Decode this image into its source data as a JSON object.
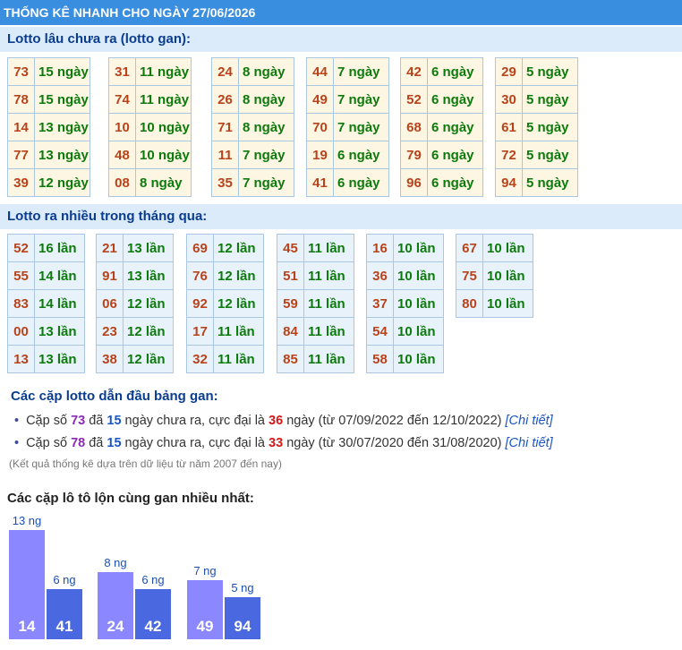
{
  "header": {
    "title": "THỐNG KÊ NHANH CHO NGÀY 27/06/2026"
  },
  "gan": {
    "title": "Lotto lâu chưa ra (lotto gan):",
    "columns": [
      [
        [
          "73",
          "15 ngày"
        ],
        [
          "78",
          "15 ngày"
        ],
        [
          "14",
          "13 ngày"
        ],
        [
          "77",
          "13 ngày"
        ],
        [
          "39",
          "12 ngày"
        ]
      ],
      [
        [
          "31",
          "11 ngày"
        ],
        [
          "74",
          "11 ngày"
        ],
        [
          "10",
          "10 ngày"
        ],
        [
          "48",
          "10 ngày"
        ],
        [
          "08",
          "8 ngày"
        ]
      ],
      [
        [
          "24",
          "8 ngày"
        ],
        [
          "26",
          "8 ngày"
        ],
        [
          "71",
          "8 ngày"
        ],
        [
          "11",
          "7 ngày"
        ],
        [
          "35",
          "7 ngày"
        ]
      ],
      [
        [
          "44",
          "7 ngày"
        ],
        [
          "49",
          "7 ngày"
        ],
        [
          "70",
          "7 ngày"
        ],
        [
          "19",
          "6 ngày"
        ],
        [
          "41",
          "6 ngày"
        ]
      ],
      [
        [
          "42",
          "6 ngày"
        ],
        [
          "52",
          "6 ngày"
        ],
        [
          "68",
          "6 ngày"
        ],
        [
          "79",
          "6 ngày"
        ],
        [
          "96",
          "6 ngày"
        ]
      ],
      [
        [
          "29",
          "5 ngày"
        ],
        [
          "30",
          "5 ngày"
        ],
        [
          "61",
          "5 ngày"
        ],
        [
          "72",
          "5 ngày"
        ],
        [
          "94",
          "5 ngày"
        ]
      ]
    ]
  },
  "nhieu": {
    "title": "Lotto ra nhiều trong tháng qua:",
    "columns": [
      [
        [
          "52",
          "16 lần"
        ],
        [
          "55",
          "14 lần"
        ],
        [
          "83",
          "14 lần"
        ],
        [
          "00",
          "13 lần"
        ],
        [
          "13",
          "13 lần"
        ]
      ],
      [
        [
          "21",
          "13 lần"
        ],
        [
          "91",
          "13 lần"
        ],
        [
          "06",
          "12 lần"
        ],
        [
          "23",
          "12 lần"
        ],
        [
          "38",
          "12 lần"
        ]
      ],
      [
        [
          "69",
          "12 lần"
        ],
        [
          "76",
          "12 lần"
        ],
        [
          "92",
          "12 lần"
        ],
        [
          "17",
          "11 lần"
        ],
        [
          "32",
          "11 lần"
        ]
      ],
      [
        [
          "45",
          "11 lần"
        ],
        [
          "51",
          "11 lần"
        ],
        [
          "59",
          "11 lần"
        ],
        [
          "84",
          "11 lần"
        ],
        [
          "85",
          "11 lần"
        ]
      ],
      [
        [
          "16",
          "10 lần"
        ],
        [
          "36",
          "10 lần"
        ],
        [
          "37",
          "10 lần"
        ],
        [
          "54",
          "10 lần"
        ],
        [
          "58",
          "10 lần"
        ]
      ],
      [
        [
          "67",
          "10 lần"
        ],
        [
          "75",
          "10 lần"
        ],
        [
          "80",
          "10 lần"
        ]
      ]
    ]
  },
  "leader": {
    "title": "Các cặp lotto dẫn đầu bảng gan:",
    "items": [
      {
        "p1": "Cặp số ",
        "pair": "73",
        "p2": " đã ",
        "days": "15",
        "p3": " ngày chưa ra, cực đại là ",
        "max": "36",
        "p4": " ngày (từ 07/09/2022 đến 12/10/2022) ",
        "link": "[Chi tiết]"
      },
      {
        "p1": "Cặp số ",
        "pair": "78",
        "p2": " đã ",
        "days": "15",
        "p3": " ngày chưa ra, cực đại là ",
        "max": "33",
        "p4": " ngày (từ 30/07/2020 đến 31/08/2020) ",
        "link": "[Chi tiết]"
      }
    ],
    "note": "(Kết quả thống kê dựa trên dữ liệu từ năm 2007 đến nay)"
  },
  "pairs": {
    "title": "Các cặp lô tô lộn cùng gan nhiều nhất:",
    "chart_data": {
      "type": "bar",
      "groups": [
        {
          "bars": [
            {
              "label": "14",
              "value": 13,
              "text": "13 ng"
            },
            {
              "label": "41",
              "value": 6,
              "text": "6 ng"
            }
          ]
        },
        {
          "bars": [
            {
              "label": "24",
              "value": 8,
              "text": "8 ng"
            },
            {
              "label": "42",
              "value": 6,
              "text": "6 ng"
            }
          ]
        },
        {
          "bars": [
            {
              "label": "49",
              "value": 7,
              "text": "7 ng"
            },
            {
              "label": "94",
              "value": 5,
              "text": "5 ng"
            }
          ]
        }
      ]
    }
  }
}
